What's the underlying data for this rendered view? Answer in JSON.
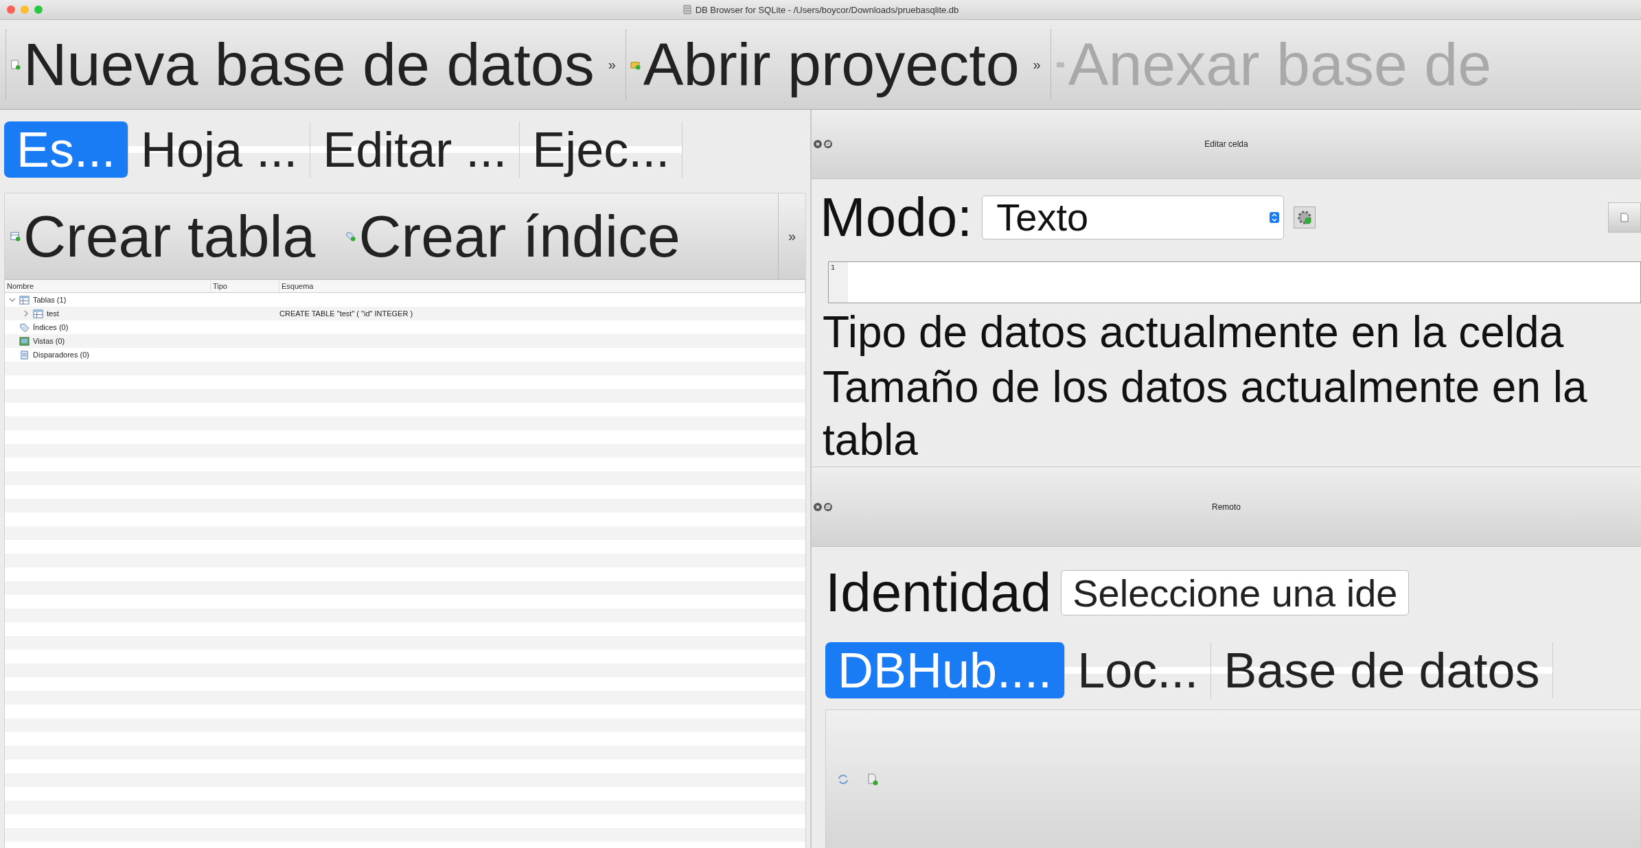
{
  "window": {
    "title": "DB Browser for SQLite - /Users/boycor/Downloads/pruebasqlite.db"
  },
  "toolbar": [
    {
      "kind": "action",
      "label": "Nueva base de datos",
      "disabled": false
    },
    {
      "kind": "overflow",
      "label": "»"
    },
    {
      "kind": "action",
      "label": "Abrir proyecto",
      "disabled": false
    },
    {
      "kind": "overflow",
      "label": "»"
    },
    {
      "kind": "action",
      "label": "Anexar base de",
      "disabled": true
    }
  ],
  "main_tabs": [
    {
      "label": "Es...",
      "selected": true
    },
    {
      "label": "Hoja ...",
      "selected": false
    },
    {
      "label": "Editar ...",
      "selected": false
    },
    {
      "label": "Ejec...",
      "selected": false
    }
  ],
  "structure_toolbar": [
    {
      "kind": "action",
      "label": "Crear tabla"
    },
    {
      "kind": "action",
      "label": "Crear índice"
    },
    {
      "kind": "overflow",
      "label": "»"
    }
  ],
  "tree": {
    "columns": [
      "Nombre",
      "Tipo",
      "Esquema"
    ],
    "rows": [
      {
        "kind": "tables",
        "name": "Tablas (1)",
        "expanded": true,
        "children": [
          {
            "kind": "table",
            "name": "test",
            "schema": "CREATE TABLE \"test\" ( \"id\" INTEGER )",
            "expanded": false
          }
        ]
      },
      {
        "kind": "indices",
        "name": "Índices (0)"
      },
      {
        "kind": "views",
        "name": "Vistas (0)"
      },
      {
        "kind": "triggers",
        "name": "Disparadores (0)"
      }
    ]
  },
  "edit_cell": {
    "title": "Editar celda",
    "mode_label": "Modo:",
    "mode_value": "Texto",
    "line_numbers": [
      "1"
    ],
    "type_info": "Tipo de datos actualmente en la celda",
    "size_info": "Tamaño de los datos actualmente en la tabla"
  },
  "remote": {
    "title": "Remoto",
    "identity_label": "Identidad",
    "identity_value": "Seleccione una ide",
    "tabs": [
      {
        "label": "DBHub....",
        "selected": true
      },
      {
        "label": "Loc...",
        "selected": false
      },
      {
        "label": "Base de datos",
        "selected": false
      }
    ]
  }
}
